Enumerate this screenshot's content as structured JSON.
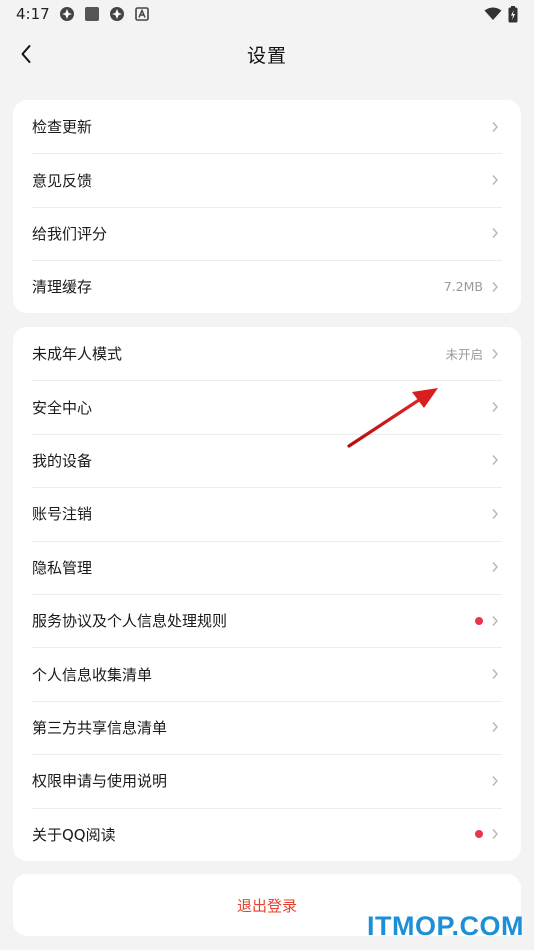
{
  "status_bar": {
    "time": "4:17",
    "icons": [
      "app-notification-icon",
      "square-notification-icon",
      "app-notification-icon",
      "a-notification-icon"
    ],
    "right_icons": [
      "wifi-icon",
      "battery-icon"
    ]
  },
  "nav": {
    "title": "设置",
    "back_icon": "chevron-left-icon"
  },
  "groups": [
    {
      "items": [
        {
          "label": "检查更新",
          "value": "",
          "dot": false
        },
        {
          "label": "意见反馈",
          "value": "",
          "dot": false
        },
        {
          "label": "给我们评分",
          "value": "",
          "dot": false
        },
        {
          "label": "清理缓存",
          "value": "7.2MB",
          "dot": false
        }
      ]
    },
    {
      "items": [
        {
          "label": "未成年人模式",
          "value": "未开启",
          "dot": false
        },
        {
          "label": "安全中心",
          "value": "",
          "dot": false
        },
        {
          "label": "我的设备",
          "value": "",
          "dot": false
        },
        {
          "label": "账号注销",
          "value": "",
          "dot": false
        },
        {
          "label": "隐私管理",
          "value": "",
          "dot": false
        },
        {
          "label": "服务协议及个人信息处理规则",
          "value": "",
          "dot": true
        },
        {
          "label": "个人信息收集清单",
          "value": "",
          "dot": false
        },
        {
          "label": "第三方共享信息清单",
          "value": "",
          "dot": false
        },
        {
          "label": "权限申请与使用说明",
          "value": "",
          "dot": false
        },
        {
          "label": "关于QQ阅读",
          "value": "",
          "dot": true
        }
      ]
    }
  ],
  "logout": {
    "label": "退出登录"
  },
  "watermark": "ITMOP.COM",
  "colors": {
    "background": "#f3f3f3",
    "card": "#ffffff",
    "logout_text": "#e8412f",
    "dot": "#e8374b",
    "annotation_arrow": "#d81e1e",
    "watermark": "#1c8fd6"
  }
}
